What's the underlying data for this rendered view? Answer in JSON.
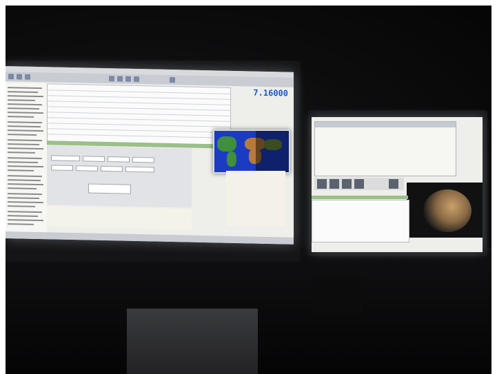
{
  "left_screen": {
    "frequency": "7.16000"
  },
  "colors": {
    "screen_bg": "#eeeeea",
    "log_highlight": "#9bbf89",
    "frequency_text": "#1f56c9",
    "map_ocean": "#1b3cc2"
  }
}
